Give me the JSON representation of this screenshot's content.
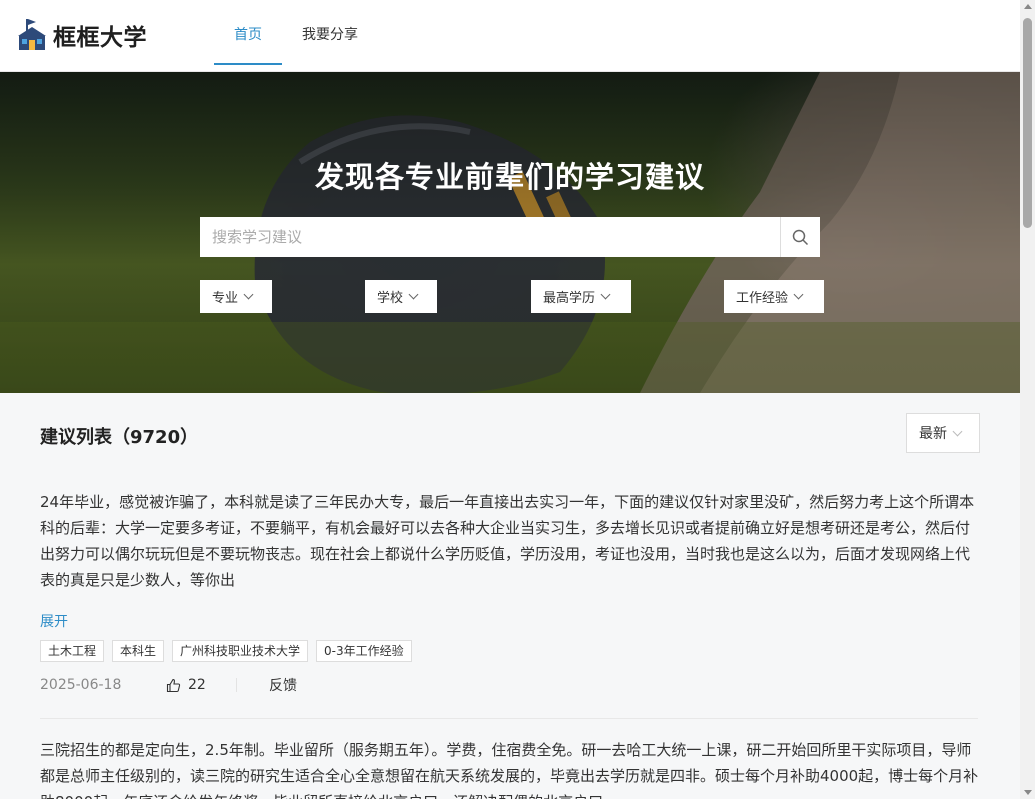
{
  "app": {
    "logo_text": "框框大学"
  },
  "nav": {
    "items": [
      {
        "label": "首页",
        "active": true
      },
      {
        "label": "我要分享",
        "active": false
      }
    ]
  },
  "hero": {
    "title": "发现各专业前辈们的学习建议",
    "search_placeholder": "搜索学习建议",
    "filters": [
      {
        "label": "专业"
      },
      {
        "label": "学校"
      },
      {
        "label": "最高学历"
      },
      {
        "label": "工作经验"
      }
    ]
  },
  "list": {
    "title": "建议列表（9720）",
    "sort_label": "最新"
  },
  "posts": [
    {
      "text": "24年毕业，感觉被诈骗了，本科就是读了三年民办大专，最后一年直接出去实习一年，下面的建议仅针对家里没矿，然后努力考上这个所谓本科的后辈：大学一定要多考证，不要躺平，有机会最好可以去各种大企业当实习生，多去增长见识或者提前确立好是想考研还是考公，然后付出努力可以偶尔玩玩但是不要玩物丧志。现在社会上都说什么学历贬值，学历没用，考证也没用，当时我也是这么以为，后面才发现网络上代表的真是只是少数人，等你出",
      "expand_label": "展开",
      "tags": [
        "土木工程",
        "本科生",
        "广州科技职业技术大学",
        "0-3年工作经验"
      ],
      "date": "2025-06-18",
      "likes": "22",
      "feedback_label": "反馈"
    },
    {
      "text": "三院招生的都是定向生，2.5年制。毕业留所（服务期五年）。学费，住宿费全免。研一去哈工大统一上课，研二开始回所里干实际项目，导师都是总师主任级别的，读三院的研究生适合全心全意想留在航天系统发展的，毕竟出去学历就是四非。硕士每个月补助4000起，博士每个月补助8000起，年底还会给发年终奖，毕业留所直接给北京户口，还解决配偶的北京户口"
    }
  ],
  "colors": {
    "accent": "#2d8cc7",
    "background": "#f6f7f8"
  }
}
